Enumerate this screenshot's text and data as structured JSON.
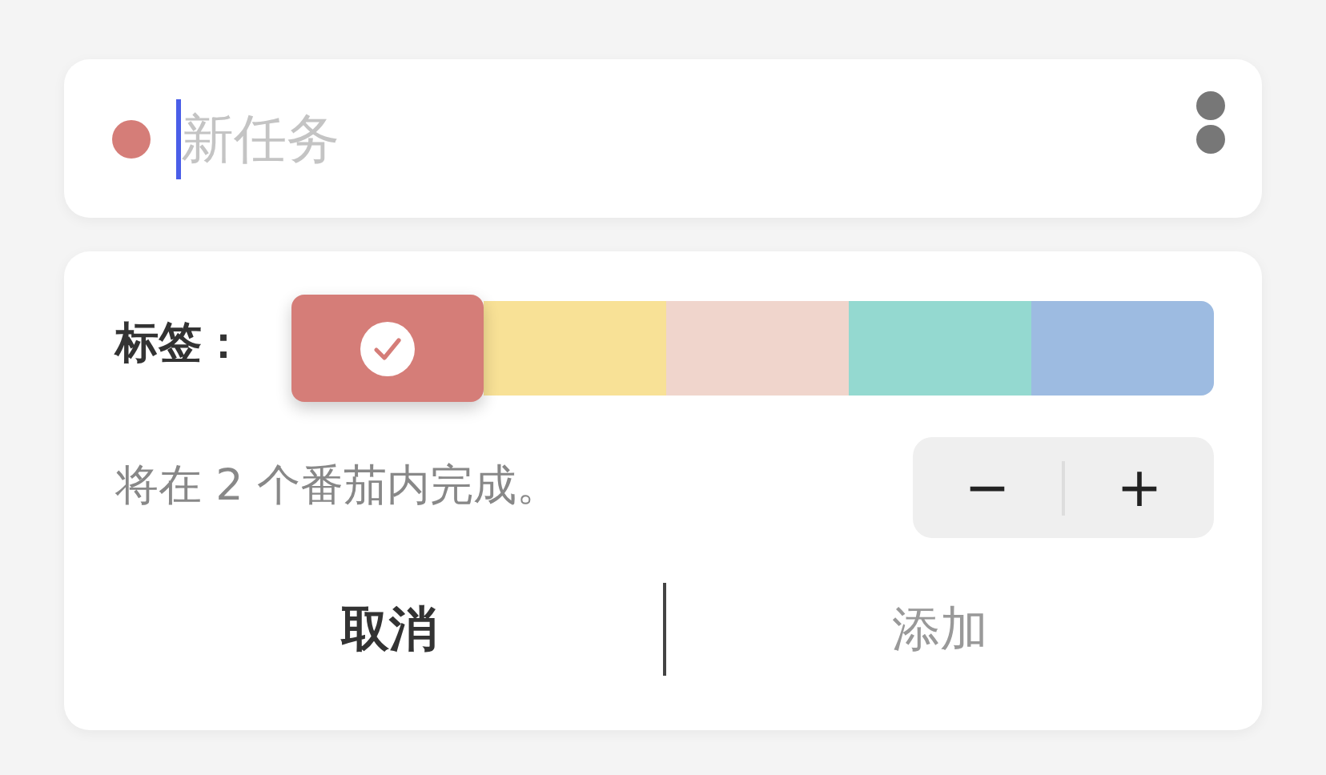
{
  "task": {
    "placeholder": "新任务",
    "color": "#d57d78"
  },
  "tags": {
    "label": "标签：",
    "items": [
      {
        "color": "#d57d78",
        "selected": true
      },
      {
        "color": "#f8e196",
        "selected": false
      },
      {
        "color": "#f0d5cc",
        "selected": false
      },
      {
        "color": "#94d9d0",
        "selected": false
      },
      {
        "color": "#9dbbe1",
        "selected": false
      }
    ]
  },
  "estimate": {
    "text": "将在 2 个番茄内完成。",
    "minus": "−",
    "plus": "+"
  },
  "buttons": [
    {
      "label": "取消",
      "disabled": false
    },
    {
      "label": "添加",
      "disabled": true
    }
  ]
}
